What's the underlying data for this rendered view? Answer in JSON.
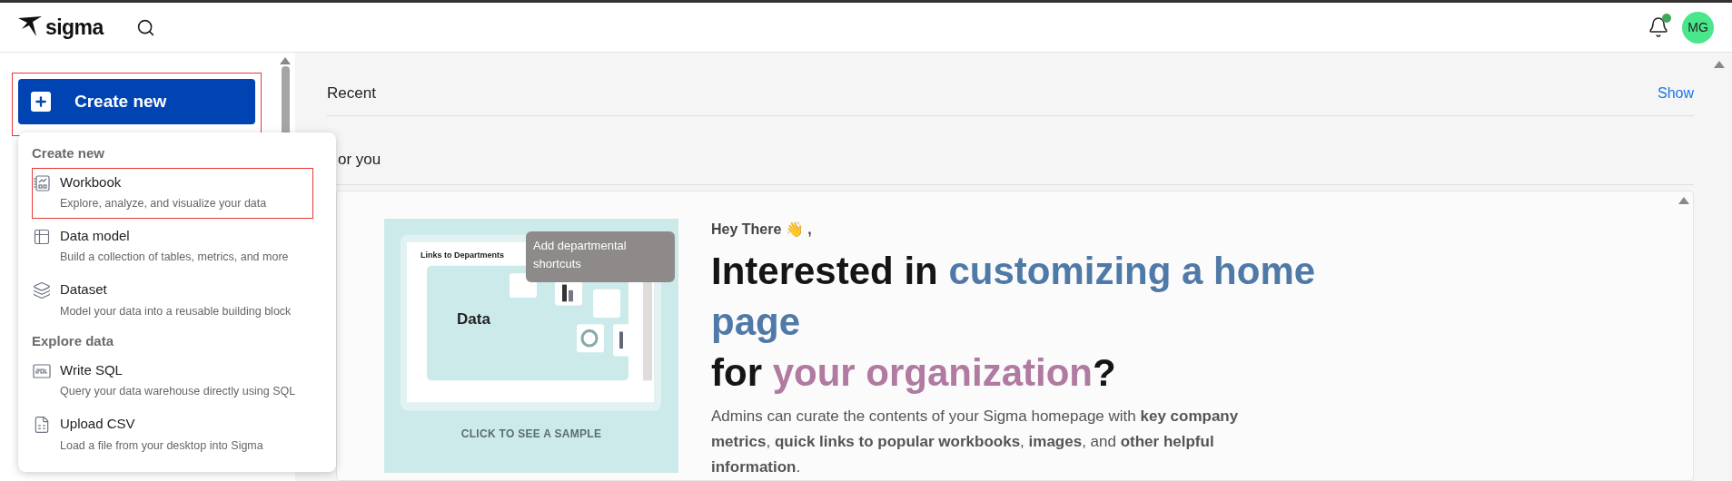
{
  "top_bar": {
    "logo": "sigma",
    "avatar": "MG",
    "notification_dot": true
  },
  "sidebar": {
    "create_button": "Create new",
    "highlighted": true
  },
  "create_menu": {
    "sections": [
      {
        "heading": "Create new",
        "items": [
          {
            "kind": "workbook",
            "title": "Workbook",
            "description": "Explore, analyze, and visualize your data",
            "highlighted": true
          },
          {
            "kind": "data-model",
            "title": "Data model",
            "description": "Build a collection of tables, metrics, and more",
            "highlighted": false
          },
          {
            "kind": "dataset",
            "title": "Dataset",
            "description": "Model your data into a reusable building block",
            "highlighted": false
          }
        ]
      },
      {
        "heading": "Explore data",
        "items": [
          {
            "kind": "sql",
            "title": "Write SQL",
            "description": "Query your data warehouse directly using SQL",
            "highlighted": false
          },
          {
            "kind": "csv",
            "title": "Upload CSV",
            "description": "Load a file from your desktop into Sigma",
            "highlighted": false
          }
        ]
      }
    ]
  },
  "recent": {
    "title": "Recent",
    "action": "Show"
  },
  "for_you": {
    "title": "or you",
    "sample": {
      "window_title": "Links to Departments",
      "tooltip": "Add departmental shortcuts",
      "tile": "Data",
      "caption": "CLICK TO SEE A SAMPLE"
    },
    "greeting": "Hey There 👋 ,",
    "heading_lines": [
      [
        {
          "kind": "plain",
          "text": "Interested in "
        },
        {
          "kind": "blue",
          "text": "customizing a home page"
        }
      ],
      [
        {
          "kind": "plain",
          "text": "for "
        },
        {
          "kind": "purple",
          "text": "your organization"
        },
        {
          "kind": "plain",
          "text": "?"
        }
      ]
    ],
    "body": "Admins can curate the contents of your Sigma homepage with **key company metrics**, **quick links to popular workbooks**, **images**, and **other helpful information**."
  }
}
